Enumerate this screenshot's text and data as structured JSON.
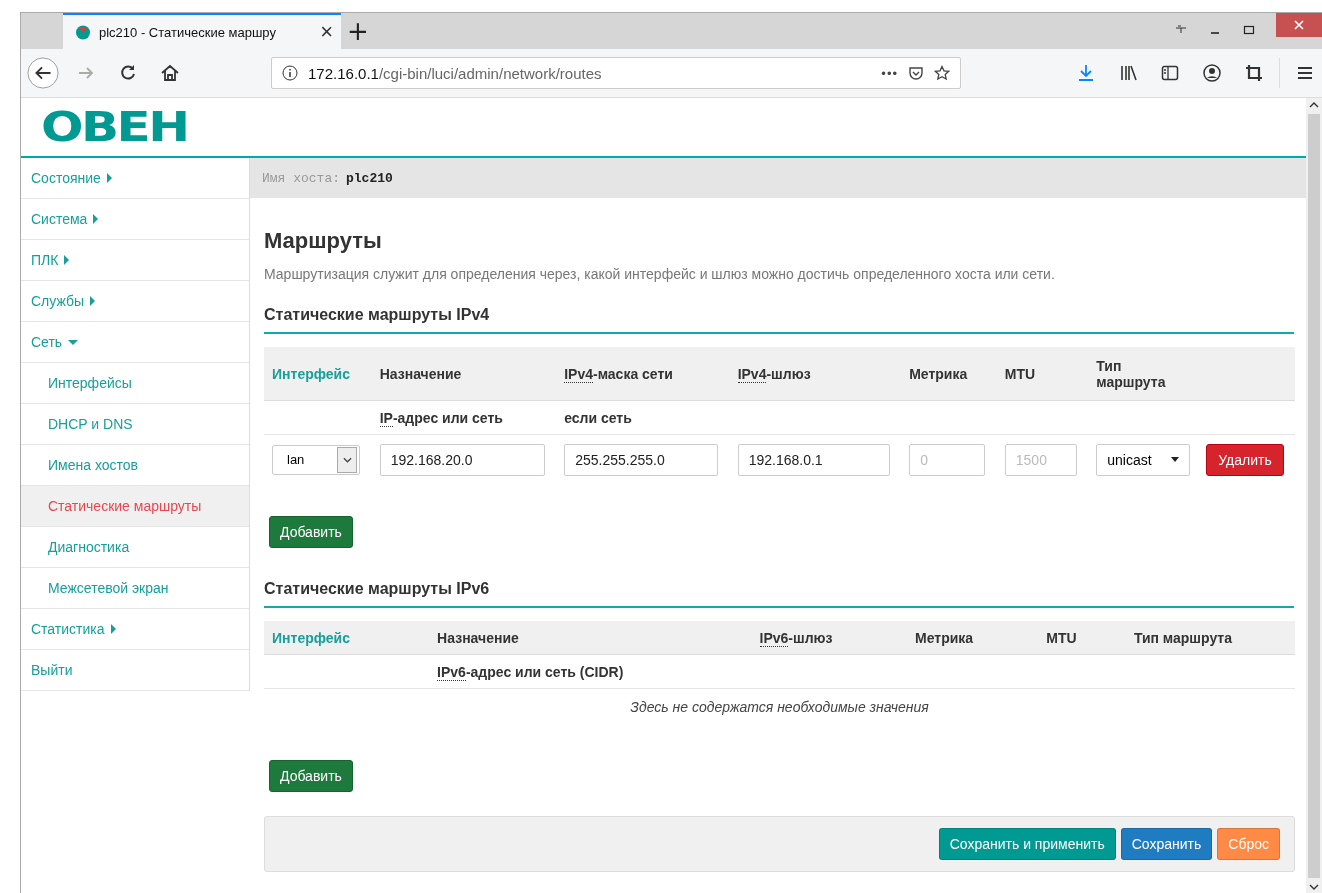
{
  "browser": {
    "tab_title": "plc210 - Статические маршру",
    "tab_close": "×",
    "new_tab": "+",
    "url_host": "172.16.0.1",
    "url_path": "/cgi-bin/luci/admin/network/routes",
    "page_actions": "•••"
  },
  "logo": "ОВЕН",
  "hostbar": {
    "label": "Имя хоста:",
    "value": "plc210"
  },
  "sidebar": [
    {
      "label": "Состояние",
      "expanded": false,
      "selected": false
    },
    {
      "label": "Система",
      "expanded": false,
      "selected": false
    },
    {
      "label": "ПЛК",
      "expanded": false,
      "selected": false
    },
    {
      "label": "Службы",
      "expanded": false,
      "selected": false
    },
    {
      "label": "Сеть",
      "expanded": true,
      "selected": false,
      "children": [
        {
          "label": "Интерфейсы",
          "selected": false
        },
        {
          "label": "DHCP и DNS",
          "selected": false
        },
        {
          "label": "Имена хостов",
          "selected": false
        },
        {
          "label": "Статические маршруты",
          "selected": true
        },
        {
          "label": "Диагностика",
          "selected": false
        },
        {
          "label": "Межсетевой экран",
          "selected": false
        }
      ]
    },
    {
      "label": "Статистика",
      "expanded": false,
      "selected": false
    },
    {
      "label": "Выйти",
      "selected": false
    }
  ],
  "title": "Маршруты",
  "description": "Маршрутизация служит для определения через, какой интерфейс и шлюз можно достичь определенного хоста или сети.",
  "ipv4": {
    "title": "Статические маршруты IPv4",
    "columns": [
      {
        "kind": "link",
        "label": "Интерфейс"
      },
      {
        "kind": "plain",
        "label": "Назначение",
        "sub_abbr": "IP",
        "sub_rest": "-адрес или сеть"
      },
      {
        "kind": "plain",
        "abbr": "IPv4",
        "label": "-маска сети",
        "sub_rest": "если сеть"
      },
      {
        "kind": "plain",
        "abbr": "IPv4",
        "label": "-шлюз"
      },
      {
        "kind": "plain",
        "label": "Метрика"
      },
      {
        "kind": "plain",
        "label": "MTU"
      },
      {
        "kind": "plain",
        "label": "Тип маршрута"
      }
    ],
    "rows": [
      {
        "interface": "lan",
        "target": "192.168.20.0",
        "netmask": "255.255.255.0",
        "gateway": "192.168.0.1",
        "metric_placeholder": "0",
        "mtu_placeholder": "1500",
        "type": "unicast",
        "delete": "Удалить"
      }
    ],
    "add": "Добавить"
  },
  "ipv6": {
    "title": "Статические маршруты IPv6",
    "columns": [
      {
        "kind": "link",
        "label": "Интерфейс"
      },
      {
        "kind": "plain",
        "label": "Назначение",
        "sub_abbr": "IPv6",
        "sub_rest": "-адрес или сеть (CIDR)"
      },
      {
        "kind": "plain",
        "abbr": "IPv6",
        "label": "-шлюз"
      },
      {
        "kind": "plain",
        "label": "Метрика"
      },
      {
        "kind": "plain",
        "label": "MTU"
      },
      {
        "kind": "plain",
        "label": "Тип маршрута"
      }
    ],
    "empty": "Здесь не содержатся необходимые значения",
    "add": "Добавить"
  },
  "footer": [
    {
      "kind": "apply",
      "label": "Сохранить и применить"
    },
    {
      "kind": "save",
      "label": "Сохранить"
    },
    {
      "kind": "reset",
      "label": "Сброс"
    }
  ]
}
